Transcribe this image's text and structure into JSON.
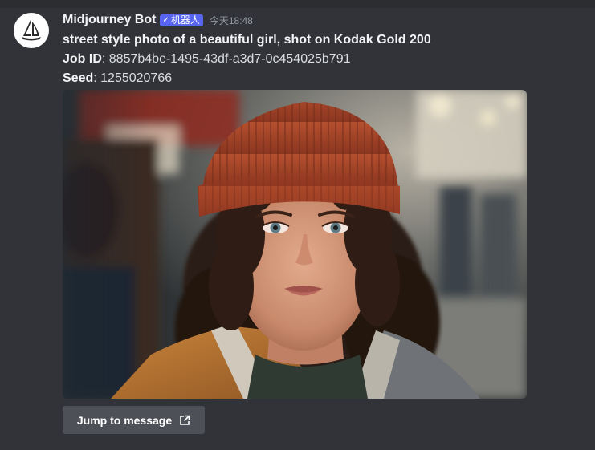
{
  "message": {
    "author": "Midjourney Bot",
    "badge": "机器人",
    "badge_check": "✓",
    "timestamp": "今天18:48",
    "prompt": "street style photo of a beautiful girl, shot on Kodak Gold 200",
    "job_id_label": "Job ID",
    "job_id_value": ": 8857b4be-1495-43df-a3d7-0c454025b791",
    "seed_label": "Seed",
    "seed_value": ": 1255020766"
  },
  "actions": {
    "jump_label": "Jump to message"
  },
  "colors": {
    "background": "#313338",
    "badge": "#5865f2",
    "button": "#4e5058",
    "hat": "#a8472a",
    "jacket": "#b8742e"
  },
  "icons": {
    "avatar": "sailboat-icon",
    "external": "external-link-icon"
  }
}
